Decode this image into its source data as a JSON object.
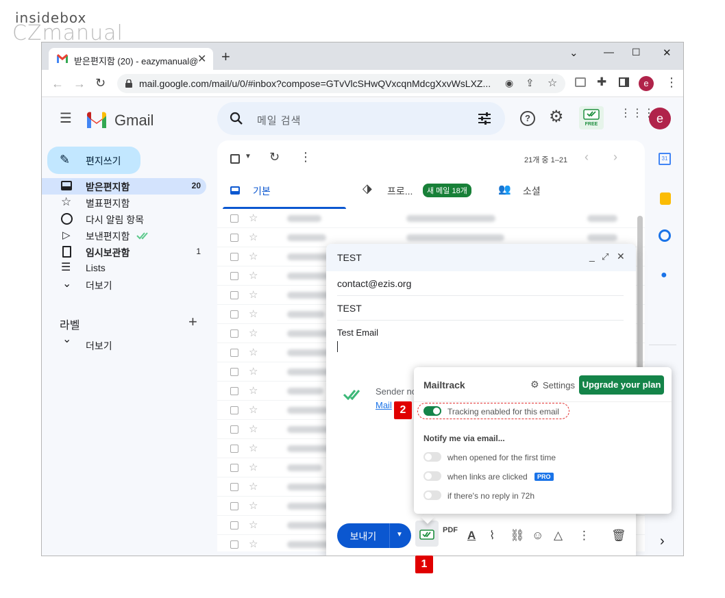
{
  "watermark": {
    "line1": "insidebox",
    "line2": "CZmanual"
  },
  "browser": {
    "tab_title": "받은편지함 (20) - eazymanual@",
    "url": "mail.google.com/mail/u/0/#inbox?compose=GTvVlcSHwQVxcqnMdcgXxvWsLXZ...",
    "profile_initial": "e"
  },
  "gmail": {
    "brand": "Gmail",
    "search_placeholder": "메일 검색",
    "compose_label": "편지쓰기",
    "mailtrack_badge": "FREE",
    "profile_initial": "e",
    "nav": [
      {
        "label": "받은편지함",
        "count": "20",
        "icon": "inbox-icon",
        "active": true
      },
      {
        "label": "별표편지함",
        "count": "",
        "icon": "star-icon"
      },
      {
        "label": "다시 알림 항목",
        "count": "",
        "icon": "clock-icon"
      },
      {
        "label": "보낸편지함",
        "count": "",
        "icon": "send-icon"
      },
      {
        "label": "임시보관함",
        "count": "1",
        "icon": "draft-icon"
      },
      {
        "label": "Lists",
        "count": "",
        "icon": "list-icon"
      },
      {
        "label": "더보기",
        "count": "",
        "icon": "chevron-down-icon"
      }
    ],
    "labels_heading": "라벨",
    "labels_more": "더보기",
    "pagination": "21개 중 1–21",
    "tabs": {
      "primary": "기본",
      "promotions": "프로...",
      "promotions_badge": "새 메일 18개",
      "social": "소셜"
    }
  },
  "compose": {
    "title": "TEST",
    "to": "contact@ezis.org",
    "subject": "TEST",
    "body": "Test Email",
    "sender_note": "Sender no",
    "sender_link": "Mail",
    "send_label": "보내기"
  },
  "mailtrack": {
    "title": "Mailtrack",
    "settings_label": "Settings",
    "upgrade_label": "Upgrade your plan",
    "tracking_label": "Tracking enabled for this email",
    "tracking_enabled": true,
    "notify_heading": "Notify me via email...",
    "options": [
      {
        "label": "when opened for the first time",
        "enabled": false,
        "pro": false
      },
      {
        "label": "when links are clicked",
        "enabled": false,
        "pro": true
      },
      {
        "label": "if there's no reply in 72h",
        "enabled": false,
        "pro": false
      }
    ],
    "pro_label": "PRO"
  },
  "annotations": {
    "step1": "1",
    "step2": "2",
    "color": "#e00000"
  },
  "colors": {
    "mailtrack_green": "#148449",
    "gmail_blue": "#0b57d0",
    "compose_chip": "#c2e7ff"
  }
}
